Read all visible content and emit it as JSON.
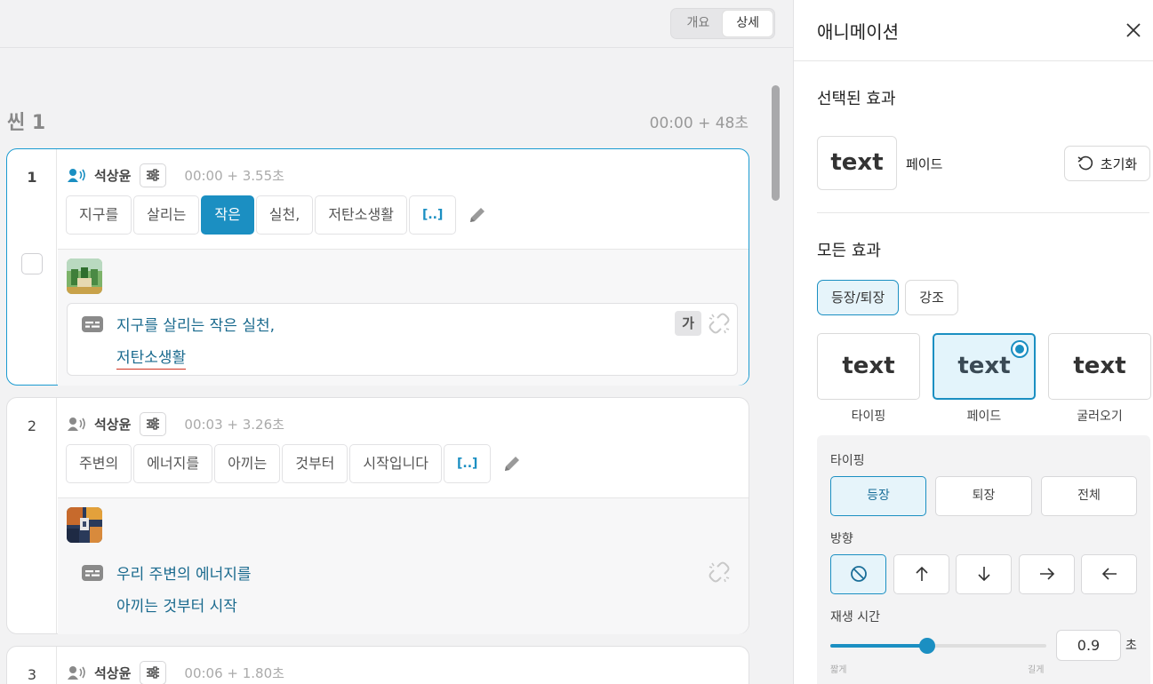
{
  "view_toggle": {
    "options": [
      "개요",
      "상세"
    ],
    "selected": "상세"
  },
  "scene": {
    "title": "씬 1",
    "time": "00:00 + 48초"
  },
  "cards": [
    {
      "index": "1",
      "speaker": "석상윤",
      "time": "00:00 + 3.55초",
      "words": [
        "지구를",
        "살리는",
        "작은",
        "실천,",
        "저탄소생활",
        "[..]"
      ],
      "selected_word": "작은",
      "caption_line1": "지구를  살리는 작은 실천,",
      "caption_line2": "저탄소생활",
      "caption_badge": "가"
    },
    {
      "index": "2",
      "speaker": "석상윤",
      "time": "00:03 + 3.26초",
      "words": [
        "주변의",
        "에너지를",
        "아끼는",
        "것부터",
        "시작입니다",
        "[..]"
      ],
      "caption_line1": "우리 주변의 에너지를",
      "caption_line2": "아끼는 것부터 시작"
    },
    {
      "index": "3",
      "speaker": "석상윤",
      "time": "00:06 + 1.80초"
    }
  ],
  "panel": {
    "title": "애니메이션",
    "selected_section": "선택된 효과",
    "selected_preview": "text",
    "selected_name": "페이드",
    "reset_label": "초기화",
    "all_section": "모든 효과",
    "tabs": [
      "등장/퇴장",
      "강조"
    ],
    "active_tab": "등장/퇴장",
    "effects": [
      {
        "preview": "text",
        "label": "타이핑"
      },
      {
        "preview": "text",
        "label": "페이드"
      },
      {
        "preview": "text",
        "label": "굴러오기"
      }
    ],
    "selected_effect": "페이드",
    "options_title": "타이핑",
    "mode_buttons": [
      "등장",
      "퇴장",
      "전체"
    ],
    "active_mode": "등장",
    "direction_label": "방향",
    "directions": [
      "none-icon",
      "arrow-up-icon",
      "arrow-down-icon",
      "arrow-right-icon",
      "arrow-left-icon"
    ],
    "active_direction": "none-icon",
    "duration_label": "재생 시간",
    "duration_value": "0.9",
    "duration_unit": "초",
    "duration_fraction": 0.45,
    "slider_min_label": "짧게",
    "slider_max_label": "길게"
  },
  "colors": {
    "accent": "#1b8fc2",
    "caption_text": "#1a6a8e"
  }
}
